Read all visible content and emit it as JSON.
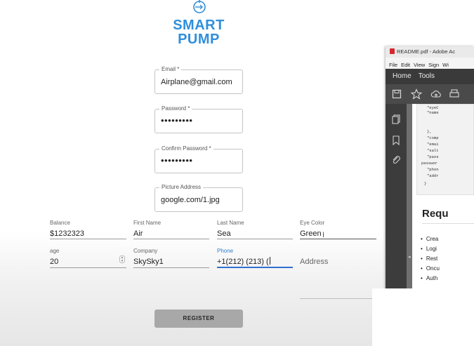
{
  "logo": {
    "line1": "SMART",
    "line2": "PUMP"
  },
  "auth_fields": {
    "email": {
      "label": "Email *",
      "value": "Airplane@gmail.com"
    },
    "password": {
      "label": "Password *",
      "value": "•••••••••"
    },
    "confirm_password": {
      "label": "Confirm Password *",
      "value": "•••••••••"
    },
    "picture_address": {
      "label": "Picture Address",
      "value": "google.com/1.jpg"
    }
  },
  "row1": {
    "balance": {
      "label": "Balance",
      "value": "$1232323"
    },
    "first_name": {
      "label": "First Name",
      "value": "Air"
    },
    "last_name": {
      "label": "Last Name",
      "value": "Sea"
    },
    "eye_color": {
      "label": "Eye Color",
      "value": "Green"
    }
  },
  "row2": {
    "age": {
      "label": "age",
      "value": "20"
    },
    "company": {
      "label": "Company",
      "value": "SkySky1"
    },
    "phone": {
      "label": "Phone",
      "value": "+1(212) (213) ("
    },
    "address": {
      "placeholder": "Address"
    }
  },
  "register_label": "REGISTER",
  "colors": {
    "brand": "#2f8fdd",
    "focus": "#2f6fd0",
    "button": "#a8a8a8"
  },
  "pdf_window": {
    "title": "README.pdf - Adobe Ac",
    "menu": [
      "File",
      "Edit",
      "View",
      "Sign",
      "Wi"
    ],
    "nav": [
      "Home",
      "Tools"
    ],
    "toolbar_icons": [
      "save-icon",
      "star-icon",
      "cloud-upload-icon",
      "print-icon"
    ],
    "left_icons": [
      "pages-icon",
      "bookmark-icon",
      "paperclip-icon"
    ],
    "code_lines": [
      "\"eyeC",
      "\"name",
      "",
      "},",
      "\"comp",
      "\"emai",
      "\"salt",
      "\"pass",
      "passwor",
      "\"phon",
      "\"addr",
      "}"
    ],
    "heading": "Requ",
    "bullets": [
      "Crea",
      "Logi",
      "Rest",
      "Oncu",
      "Auth"
    ]
  }
}
